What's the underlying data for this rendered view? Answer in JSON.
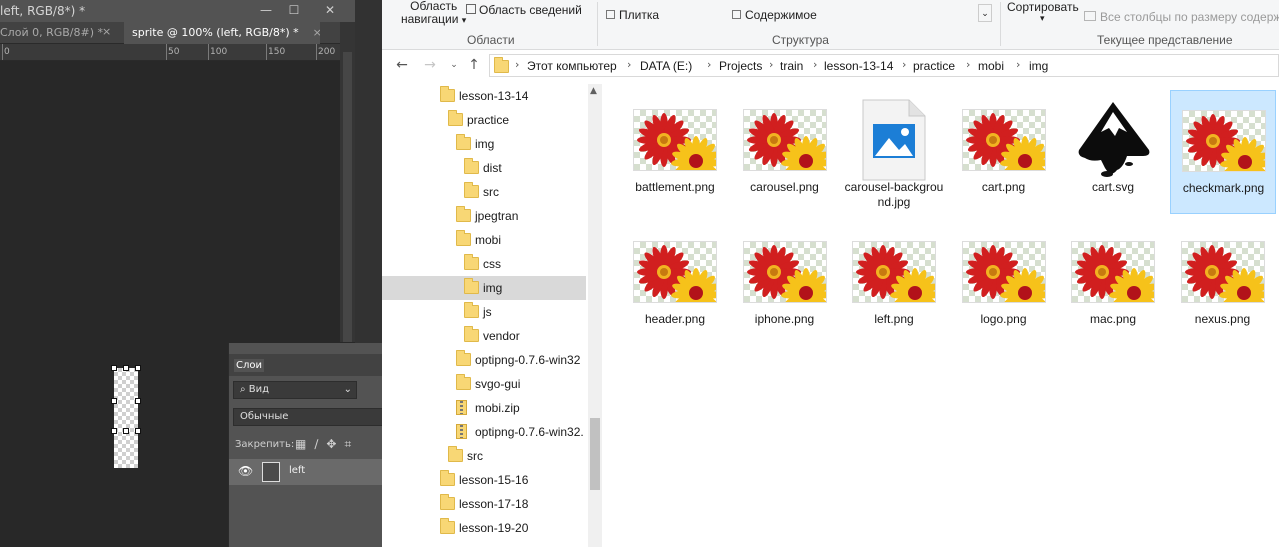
{
  "photoshop": {
    "title_fragment": "left, RGB/8*) *",
    "tabs": [
      {
        "label": "Слой 0, RGB/8#) *",
        "close": "×"
      },
      {
        "label": "sprite @ 100% (left, RGB/8*) *",
        "close": "×"
      }
    ],
    "ruler_ticks": [
      "0",
      "50",
      "100",
      "150",
      "200"
    ],
    "layers_panel": {
      "tab": "Слои",
      "filter": "Вид",
      "blend_mode": "Обычные",
      "lock_label": "Закрепить:",
      "layer_name": "left"
    }
  },
  "explorer": {
    "ribbon": {
      "nav_pane_line1": "Область",
      "nav_pane_line2": "навигации",
      "details_pane": "Область сведений",
      "group_panes": "Области",
      "tiles": "Плитка",
      "content": "Содержимое",
      "group_structure": "Структура",
      "sort": "Сортировать",
      "fit_columns": "Все столбцы по размеру содерж",
      "group_current_view": "Текущее представление"
    },
    "breadcrumbs": [
      "Этот компьютер",
      "DATA (E:)",
      "Projects",
      "train",
      "lesson-13-14",
      "practice",
      "mobi",
      "img"
    ],
    "tree": [
      {
        "label": "lesson-13-14",
        "type": "folder"
      },
      {
        "label": "practice",
        "type": "folder"
      },
      {
        "label": "img",
        "type": "folder"
      },
      {
        "label": "dist",
        "type": "folder"
      },
      {
        "label": "src",
        "type": "folder"
      },
      {
        "label": "jpegtran",
        "type": "folder"
      },
      {
        "label": "mobi",
        "type": "folder"
      },
      {
        "label": "css",
        "type": "folder"
      },
      {
        "label": "img",
        "type": "folder",
        "selected": true
      },
      {
        "label": "js",
        "type": "folder"
      },
      {
        "label": "vendor",
        "type": "folder"
      },
      {
        "label": "optipng-0.7.6-win32",
        "type": "folder"
      },
      {
        "label": "svgo-gui",
        "type": "folder"
      },
      {
        "label": "mobi.zip",
        "type": "zip"
      },
      {
        "label": "optipng-0.7.6-win32.",
        "type": "zip"
      },
      {
        "label": "src",
        "type": "folder"
      },
      {
        "label": "lesson-15-16",
        "type": "folder"
      },
      {
        "label": "lesson-17-18",
        "type": "folder"
      },
      {
        "label": "lesson-19-20",
        "type": "folder"
      }
    ],
    "files": [
      {
        "name": "battlement.png",
        "icon": "flower-thumbnail"
      },
      {
        "name": "carousel.png",
        "icon": "flower-thumbnail"
      },
      {
        "name": "carousel-background.jpg",
        "icon": "image-file-icon"
      },
      {
        "name": "cart.png",
        "icon": "flower-thumbnail"
      },
      {
        "name": "cart.svg",
        "icon": "inkscape-icon"
      },
      {
        "name": "checkmark.png",
        "icon": "flower-thumbnail",
        "selected": true
      },
      {
        "name": "header.png",
        "icon": "flower-thumbnail"
      },
      {
        "name": "iphone.png",
        "icon": "flower-thumbnail"
      },
      {
        "name": "left.png",
        "icon": "flower-thumbnail"
      },
      {
        "name": "logo.png",
        "icon": "flower-thumbnail"
      },
      {
        "name": "mac.png",
        "icon": "flower-thumbnail"
      },
      {
        "name": "nexus.png",
        "icon": "flower-thumbnail"
      }
    ],
    "colors": {
      "selection": "#cce8ff",
      "tree_selection": "#d9d9d9",
      "folder": "#f8d775"
    }
  }
}
